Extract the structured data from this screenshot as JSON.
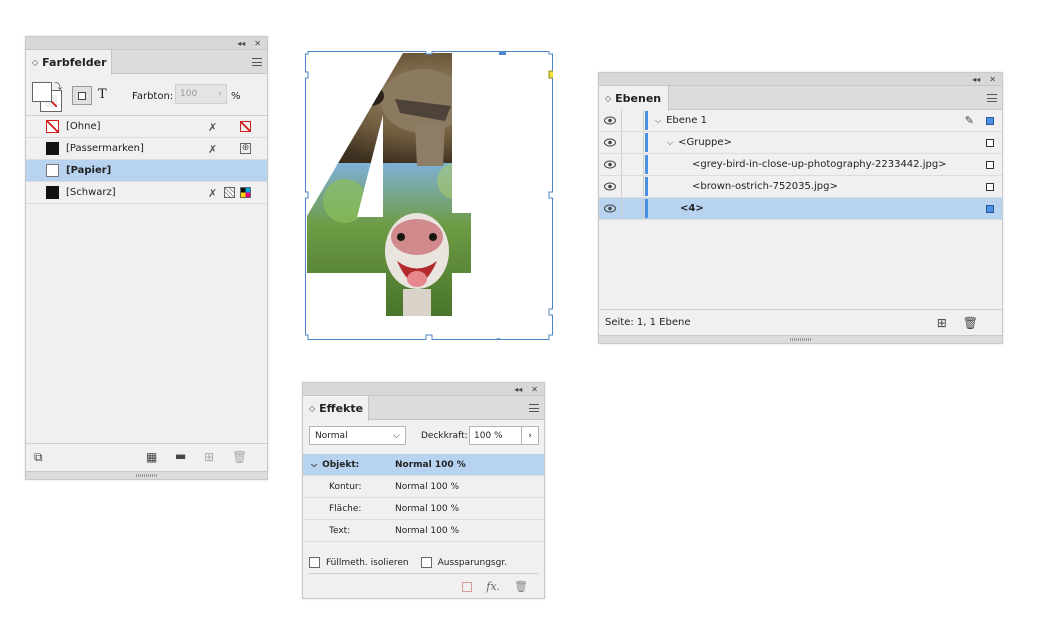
{
  "farbfelder": {
    "title": "Farbfelder",
    "farbton_label": "Farbton:",
    "farbton_value": "100",
    "farbton_unit": "%",
    "swatches": [
      {
        "name": "[Ohne]",
        "chip": "none"
      },
      {
        "name": "[Passermarken]",
        "chip": "black"
      },
      {
        "name": "[Papier]",
        "chip": "white",
        "selected": true
      },
      {
        "name": "[Schwarz]",
        "chip": "black"
      }
    ]
  },
  "ebenen": {
    "title": "Ebenen",
    "layers": [
      {
        "name": "Ebene 1",
        "indent": 1,
        "chevron": true
      },
      {
        "name": "<Gruppe>",
        "indent": 2,
        "chevron": true
      },
      {
        "name": "<grey-bird-in-close-up-photography-2233442.jpg>",
        "indent": 3
      },
      {
        "name": "<brown-ostrich-752035.jpg>",
        "indent": 3
      },
      {
        "name": "<4>",
        "indent": 2,
        "selected": true
      }
    ],
    "status": "Seite: 1, 1 Ebene"
  },
  "effekte": {
    "title": "Effekte",
    "blend_mode": "Normal",
    "deckkraft_label": "Deckkraft:",
    "deckkraft_value": "100 %",
    "rows": [
      {
        "label": "Objekt:",
        "value": "Normal 100 %",
        "selected": true
      },
      {
        "label": "Kontur:",
        "value": "Normal 100 %"
      },
      {
        "label": "Fläche:",
        "value": "Normal 100 %"
      },
      {
        "label": "Text:",
        "value": "Normal 100 %"
      }
    ],
    "check_isolate": "Füllmeth. isolieren",
    "check_knockout": "Aussparungsgr.",
    "fx_label": "fx."
  },
  "artwork": {
    "glyph": "4",
    "selection_color": "#4a86c8",
    "anchor_color": "#f5e13b"
  },
  "colors": {
    "selection_row": "#b8d3f0",
    "layer_color": "#4a90e2"
  }
}
